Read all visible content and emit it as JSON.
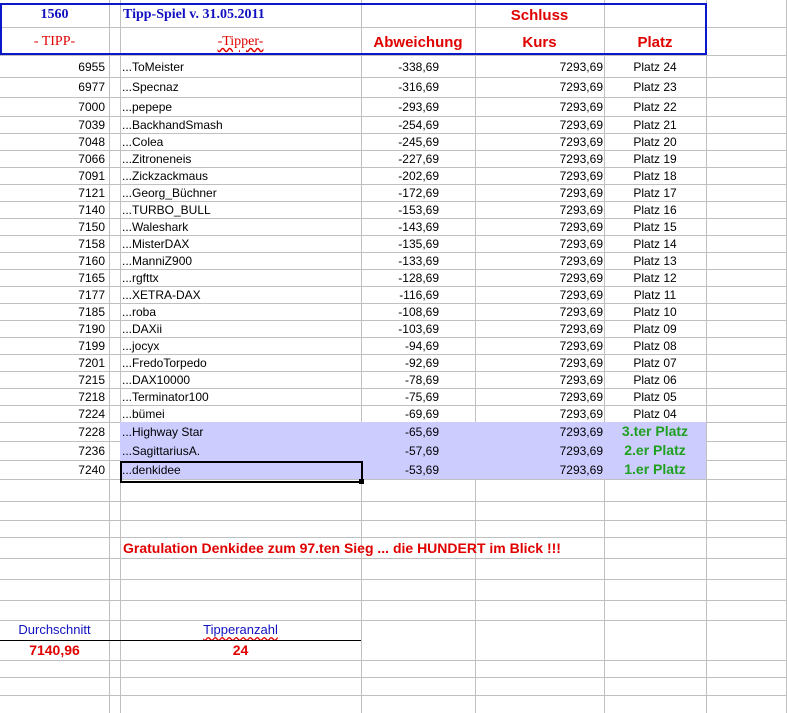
{
  "header": {
    "tipp_count": "1560",
    "title": "Tipp-Spiel v. 31.05.2011",
    "schluss": "Schluss",
    "col_tipp": "- TIPP-",
    "col_tipper": "-Tipper-",
    "col_abweichung": "Abweichung",
    "col_kurs": "Kurs",
    "col_platz": "Platz"
  },
  "rows": [
    {
      "tipp": "6955",
      "name": "...ToMeister",
      "abw": "-338,69",
      "kurs": "7293,69",
      "platz": "Platz 24"
    },
    {
      "tipp": "6977",
      "name": "...Specnaz",
      "abw": "-316,69",
      "kurs": "7293,69",
      "platz": "Platz 23"
    },
    {
      "tipp": "7000",
      "name": "...pepepe",
      "abw": "-293,69",
      "kurs": "7293,69",
      "platz": "Platz 22"
    },
    {
      "tipp": "7039",
      "name": "...BackhandSmash",
      "abw": "-254,69",
      "kurs": "7293,69",
      "platz": "Platz 21"
    },
    {
      "tipp": "7048",
      "name": "...Colea",
      "abw": "-245,69",
      "kurs": "7293,69",
      "platz": "Platz 20"
    },
    {
      "tipp": "7066",
      "name": "...Zitroneneis",
      "abw": "-227,69",
      "kurs": "7293,69",
      "platz": "Platz 19"
    },
    {
      "tipp": "7091",
      "name": "...Zickzackmaus",
      "abw": "-202,69",
      "kurs": "7293,69",
      "platz": "Platz 18"
    },
    {
      "tipp": "7121",
      "name": "...Georg_Büchner",
      "abw": "-172,69",
      "kurs": "7293,69",
      "platz": "Platz 17"
    },
    {
      "tipp": "7140",
      "name": "...TURBO_BULL",
      "abw": "-153,69",
      "kurs": "7293,69",
      "platz": "Platz 16"
    },
    {
      "tipp": "7150",
      "name": "...Waleshark",
      "abw": "-143,69",
      "kurs": "7293,69",
      "platz": "Platz 15"
    },
    {
      "tipp": "7158",
      "name": "...MisterDAX",
      "abw": "-135,69",
      "kurs": "7293,69",
      "platz": "Platz 14"
    },
    {
      "tipp": "7160",
      "name": "...ManniZ900",
      "abw": "-133,69",
      "kurs": "7293,69",
      "platz": "Platz 13"
    },
    {
      "tipp": "7165",
      "name": "...rgfttx",
      "abw": "-128,69",
      "kurs": "7293,69",
      "platz": "Platz 12"
    },
    {
      "tipp": "7177",
      "name": "...XETRA-DAX",
      "abw": "-116,69",
      "kurs": "7293,69",
      "platz": "Platz 11"
    },
    {
      "tipp": "7185",
      "name": "...roba",
      "abw": "-108,69",
      "kurs": "7293,69",
      "platz": "Platz 10"
    },
    {
      "tipp": "7190",
      "name": "...DAXii",
      "abw": "-103,69",
      "kurs": "7293,69",
      "platz": "Platz 09"
    },
    {
      "tipp": "7199",
      "name": "...jocyx",
      "abw": "-94,69",
      "kurs": "7293,69",
      "platz": "Platz 08"
    },
    {
      "tipp": "7201",
      "name": "...FredoTorpedo",
      "abw": "-92,69",
      "kurs": "7293,69",
      "platz": "Platz 07"
    },
    {
      "tipp": "7215",
      "name": "...DAX10000",
      "abw": "-78,69",
      "kurs": "7293,69",
      "platz": "Platz 06"
    },
    {
      "tipp": "7218",
      "name": "...Terminator100",
      "abw": "-75,69",
      "kurs": "7293,69",
      "platz": "Platz 05"
    },
    {
      "tipp": "7224",
      "name": "...bümei",
      "abw": "-69,69",
      "kurs": "7293,69",
      "platz": "Platz 04"
    },
    {
      "tipp": "7228",
      "name": "...Highway Star",
      "abw": "-65,69",
      "kurs": "7293,69",
      "platz": "3.ter Platz",
      "top": true
    },
    {
      "tipp": "7236",
      "name": "...SagittariusA.",
      "abw": "-57,69",
      "kurs": "7293,69",
      "platz": "2.er Platz",
      "top": true
    },
    {
      "tipp": "7240",
      "name": "...denkidee",
      "abw": "-53,69",
      "kurs": "7293,69",
      "platz": "1.er Platz",
      "top": true
    }
  ],
  "congrats": "Gratulation Denkidee zum 97.ten Sieg ...  die HUNDERT im Blick !!!",
  "summary": {
    "avg_label": "Durchschnitt",
    "avg_value": "7140,96",
    "count_label": "Tipperanzahl",
    "count_value": "24"
  },
  "colors": {
    "highlight": "#ccccff",
    "frame": "#0a18c8",
    "red": "#e00000",
    "green": "#20a020"
  }
}
